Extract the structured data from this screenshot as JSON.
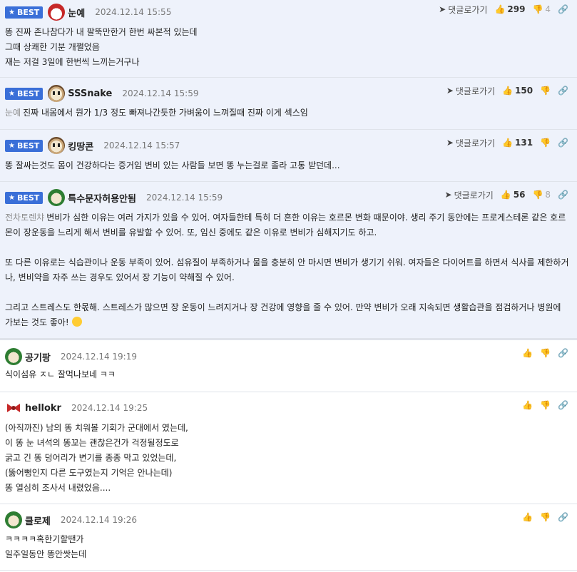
{
  "ui": {
    "best_label": "BEST",
    "reply_label": "댓글로가기",
    "icons": {
      "best_star": "★",
      "reply_arrow": "➤",
      "like": "👍",
      "dislike": "👎",
      "share": "🔗"
    }
  },
  "comments": [
    {
      "best": true,
      "nick": "눈예",
      "date": "2024.12.14 15:55",
      "likes": "299",
      "dislikes": "4",
      "lines": [
        "똥 진짜 존나참다가 내 팔뚝만한거 한번 싸본적 있는데",
        "그때 상쾌한 기분 개쩔었음",
        "재는 저걸 3일에 한번씩 느끼는거구나"
      ]
    },
    {
      "best": true,
      "nick": "SSSnake",
      "date": "2024.12.14 15:59",
      "likes": "150",
      "dislikes": "",
      "mention": "눈예",
      "lines": [
        "진짜 내몸에서 뭔가 1/3 정도 빠져나간듯한 가벼움이 느껴질때 진짜 이게 섹스임"
      ]
    },
    {
      "best": true,
      "nick": "킹땅콘",
      "date": "2024.12.14 15:57",
      "likes": "131",
      "dislikes": "",
      "lines": [
        "똥 잘싸는것도 몸이 건강하다는 증거임 변비 있는 사람들 보면 똥 누는걸로 졸라 고통 받던데..."
      ]
    },
    {
      "best": true,
      "nick": "특수문자허용안됨",
      "date": "2024.12.14 15:59",
      "likes": "56",
      "dislikes": "8",
      "mention": "전차토렌챠",
      "lines": [
        "변비가 심한 이유는 여러 가지가 있을 수 있어. 여자들한테 특히 더 흔한 이유는 호르몬 변화 때문이야. 생리 주기 동안에는 프로게스테론 같은 호르",
        "몬이 장운동을 느리게 해서 변비를 유발할 수 있어. 또, 임신 중에도 같은 이유로 변비가 심해지기도 하고.",
        "",
        "또 다른 이유로는 식습관이나 운동 부족이 있어. 섬유질이 부족하거나 물을 충분히 안 마시면 변비가 생기기 쉬워. 여자들은 다이어트를 하면서 식사를 제한하거",
        "나, 변비약을 자주 쓰는 경우도 있어서 장 기능이 약해질 수 있어.",
        "",
        "그리고 스트레스도 한몫해. 스트레스가 많으면 장 운동이 느려지거나 장 건강에 영향을 줄 수 있어. 만약 변비가 오래 지속되면 생활습관을 점검하거나 병원에",
        "가보는 것도 좋아!"
      ]
    },
    {
      "best": false,
      "nick": "공기팡",
      "date": "2024.12.14 19:19",
      "likes": "",
      "dislikes": "",
      "lines": [
        "식이섬유 ㅈㄴ 잘먹나보네 ㅋㅋ"
      ]
    },
    {
      "best": false,
      "nick": "hellokr",
      "date": "2024.12.14 19:25",
      "likes": "",
      "dislikes": "",
      "lines": [
        "(아직까진) 남의 똥 치워볼 기회가 군대에서 였는데,",
        "이 똥 눈 녀석의 똥꼬는 괜찮은건가 걱정될정도로",
        "굵고 긴 똥 덩어리가 변기를 종종 막고 있었는데,",
        "(뚫어뻥인지 다른 도구였는지 기억은 안나는데)",
        "똥 열심히 조사서 내렸었음...."
      ]
    },
    {
      "best": false,
      "nick": "클로제",
      "date": "2024.12.14 19:26",
      "likes": "",
      "dislikes": "",
      "lines": [
        "ㅋㅋㅋㅋ혹한기할땐가",
        "일주일동안 똥안쌋는데"
      ]
    }
  ]
}
